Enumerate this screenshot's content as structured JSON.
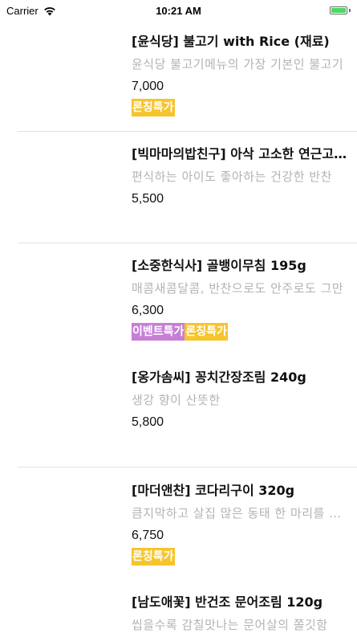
{
  "status_bar": {
    "carrier": "Carrier",
    "time": "10:21 AM",
    "battery_level": 1.0
  },
  "products": [
    {
      "name": "[윤식당] 불고기 with Rice (재료)",
      "description": "윤식당 불고기메뉴의 가장 기본인 불고기",
      "price": "7,000",
      "badges": [
        {
          "label": "론칭특가",
          "type": "launch"
        }
      ]
    },
    {
      "name": "[빅마마의밥친구] 아삭 고소한 연근고기조림",
      "description": "편식하는 아이도 좋아하는 건강한 반찬",
      "price": "5,500",
      "badges": []
    },
    {
      "name": "[소중한식사] 골뱅이무침 195g",
      "description": "매콤새콤달콤, 반찬으로도 안주로도 그만",
      "price": "6,300",
      "badges": [
        {
          "label": "이벤트특가",
          "type": "event"
        },
        {
          "label": "론칭특가",
          "type": "launch"
        }
      ]
    },
    {
      "name": "[옹가솜씨] 꽁치간장조림 240g",
      "description": "생강 향이 산뜻한",
      "price": "5,800",
      "badges": []
    },
    {
      "name": "[마더앤찬] 코다리구이 320g",
      "description": "큼지막하고 살집 많은 동태 한 마리를 통째로",
      "price": "6,750",
      "badges": [
        {
          "label": "론칭특가",
          "type": "launch"
        }
      ]
    },
    {
      "name": "[남도애꽃] 반건조 문어조림 120g",
      "description": "씹을수록 감칠맛나는 문어살의 쫄깃함",
      "price": "",
      "badges": []
    }
  ],
  "colors": {
    "launch_badge": "#f6c42d",
    "event_badge": "#c77fd6"
  }
}
